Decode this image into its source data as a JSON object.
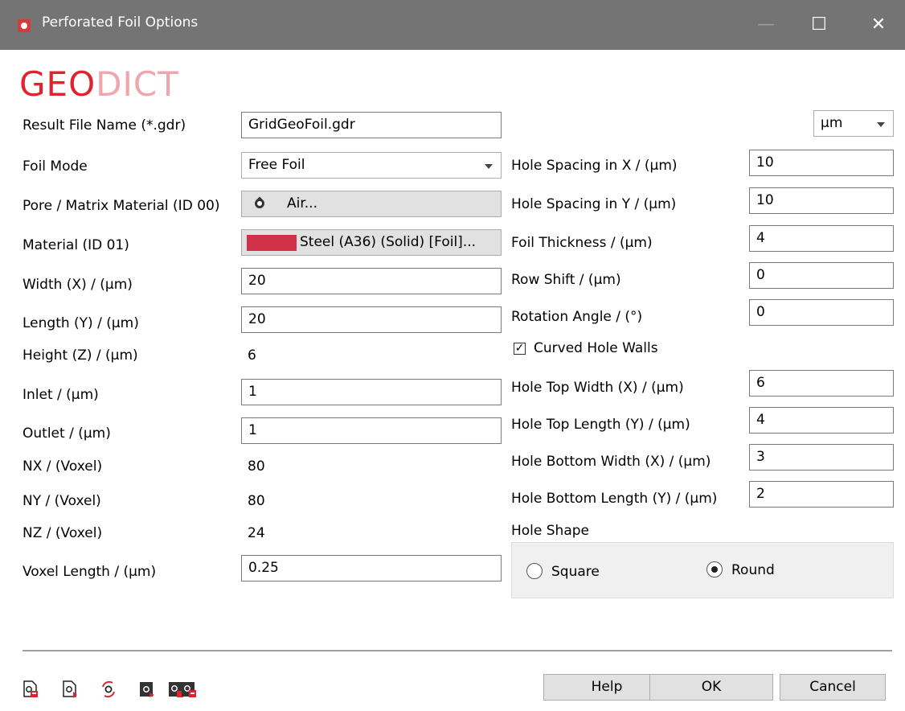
{
  "window": {
    "title": "Perforated Foil Options",
    "controls": {
      "minimize": "—",
      "maximize": "☐",
      "close": "✕"
    }
  },
  "logo": {
    "part1": "GEO",
    "part2": "DICT"
  },
  "unit_select": {
    "value": "µm"
  },
  "left": {
    "result_file": {
      "label": "Result File Name (*.gdr)",
      "value": "GridGeoFoil.gdr"
    },
    "foil_mode": {
      "label": "Foil Mode",
      "value": "Free Foil"
    },
    "pore_material": {
      "label": "Pore / Matrix Material (ID 00)",
      "value": "Air..."
    },
    "material": {
      "label": "Material (ID 01)",
      "value": "Steel (A36) (Solid) [Foil]...",
      "color": "#d03048"
    },
    "width": {
      "label": "Width (X) / (µm)",
      "value": "20"
    },
    "length": {
      "label": "Length (Y) / (µm)",
      "value": "20"
    },
    "height": {
      "label": "Height (Z) / (µm)",
      "value": "6"
    },
    "inlet": {
      "label": "Inlet / (µm)",
      "value": "1"
    },
    "outlet": {
      "label": "Outlet / (µm)",
      "value": "1"
    },
    "nx": {
      "label": "NX / (Voxel)",
      "value": "80"
    },
    "ny": {
      "label": "NY / (Voxel)",
      "value": "80"
    },
    "nz": {
      "label": "NZ / (Voxel)",
      "value": "24"
    },
    "voxel_length": {
      "label": "Voxel Length / (µm)",
      "value": "0.25"
    }
  },
  "right": {
    "hole_spacing_x": {
      "label": "Hole Spacing in X / (µm)",
      "value": "10"
    },
    "hole_spacing_y": {
      "label": "Hole Spacing in Y / (µm)",
      "value": "10"
    },
    "foil_thickness": {
      "label": "Foil Thickness / (µm)",
      "value": "4"
    },
    "row_shift": {
      "label": "Row Shift / (µm)",
      "value": "0"
    },
    "rotation_angle": {
      "label": "Rotation Angle / (°)",
      "value": "0"
    },
    "curved_hole_walls": {
      "label": "Curved Hole Walls",
      "checked": true,
      "mark": "✓"
    },
    "hole_top_width": {
      "label": "Hole Top Width (X) / (µm)",
      "value": "6"
    },
    "hole_top_length": {
      "label": "Hole Top Length (Y) / (µm)",
      "value": "4"
    },
    "hole_bottom_width": {
      "label": "Hole Bottom Width (X) / (µm)",
      "value": "3"
    },
    "hole_bottom_length": {
      "label": "Hole Bottom Length (Y) / (µm)",
      "value": "2"
    },
    "hole_shape": {
      "label": "Hole Shape",
      "options": [
        "Square",
        "Round"
      ],
      "selected": "Round"
    }
  },
  "footer": {
    "icons": [
      "save-settings-icon",
      "load-settings-icon",
      "reset-settings-icon",
      "macro-settings-icon",
      "export-settings-icon",
      "import-settings-icon"
    ],
    "help": "Help",
    "ok": "OK",
    "cancel": "Cancel"
  }
}
